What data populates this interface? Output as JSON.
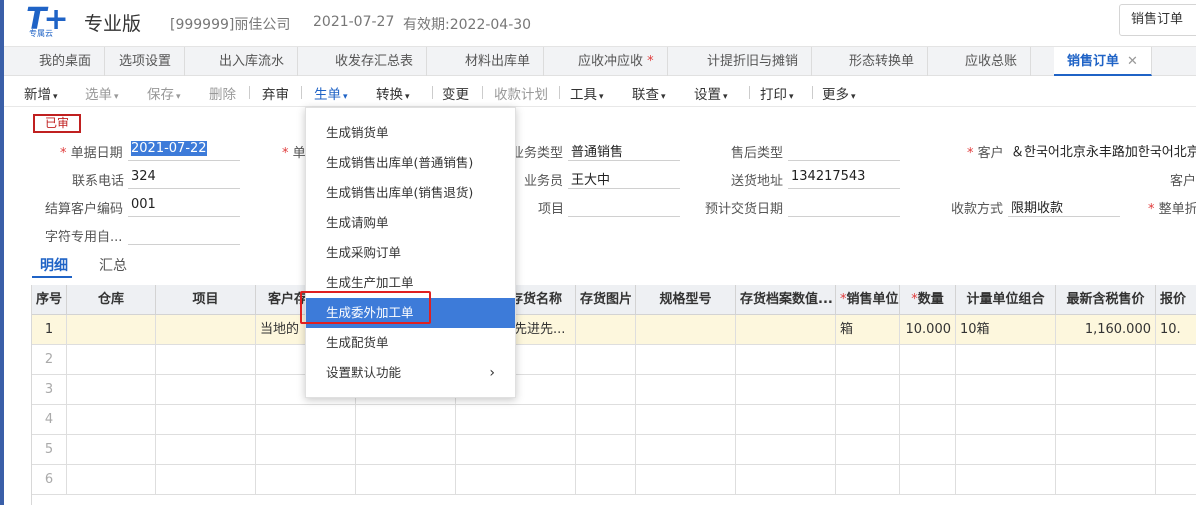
{
  "header": {
    "logo": "T+",
    "logo_sub": "专属云",
    "edition": "专业版",
    "company": "[999999]丽佳公司",
    "date": "2021-07-27",
    "validity": "有效期:2022-04-30",
    "top_button": "销售订单"
  },
  "tabs": [
    {
      "label": "我的桌面"
    },
    {
      "label": "选项设置"
    },
    {
      "label": "出入库流水"
    },
    {
      "label": "收发存汇总表"
    },
    {
      "label": "材料出库单"
    },
    {
      "label": "应收冲应收"
    },
    {
      "label": "计提折旧与摊销"
    },
    {
      "label": "形态转换单"
    },
    {
      "label": "应收总账"
    },
    {
      "label": "销售订单"
    }
  ],
  "toolbar": {
    "new": "新增",
    "select": "选单",
    "save": "保存",
    "delete": "删除",
    "discard": "弃审",
    "generate": "生单",
    "convert": "转换",
    "change": "变更",
    "collection_plan": "收款计划",
    "tools": "工具",
    "link_query": "联查",
    "settings": "设置",
    "print": "打印",
    "more": "更多"
  },
  "status_badge": "已审",
  "form": {
    "doc_date_label": "单据日期",
    "doc_date": "2021-07-22",
    "doc_no_label": "单",
    "biz_type_label": "业务类型",
    "biz_type": "普通销售",
    "after_sales_label": "售后类型",
    "after_sales": "",
    "customer_label": "客户",
    "customer": "＆한국어北京永丰路加한국어北京",
    "phone_label": "联系电话",
    "phone": "324",
    "salesman_label": "业务员",
    "salesman": "王大中",
    "ship_addr_label": "送货地址",
    "ship_addr": "134217543",
    "cust_partial_label": "客户",
    "settle_code_label": "结算客户编码",
    "settle_code": "001",
    "project_label": "项目",
    "project": "",
    "expected_date_label": "预计交货日期",
    "expected_date": "",
    "pay_method_label": "收款方式",
    "pay_method": "限期收款",
    "discount_label": "整单折",
    "char_field_label": "字符专用自...",
    "char_field": ""
  },
  "subtabs": {
    "detail": "明细",
    "summary": "汇总"
  },
  "grid": {
    "columns": [
      "序号",
      "仓库",
      "项目",
      "客户存",
      "",
      "存货名称",
      "存货图片",
      "规格型号",
      "存货档案数值...",
      "销售单位",
      "数量",
      "计量单位组合",
      "最新含税售价",
      "报价"
    ],
    "rows": [
      [
        "1",
        "",
        "",
        "当地的",
        "",
        "先进先...",
        "",
        "",
        "",
        "箱",
        "10.000",
        "10箱",
        "1,160.000",
        "10."
      ],
      [
        "2"
      ],
      [
        "3"
      ],
      [
        "4"
      ],
      [
        "5"
      ],
      [
        "6"
      ]
    ]
  },
  "dropdown": {
    "items": [
      "生成销货单",
      "生成销售出库单(普通销售)",
      "生成销售出库单(销售退货)",
      "生成请购单",
      "生成采购订单",
      "生成生产加工单",
      "生成委外加工单",
      "生成配货单",
      "设置默认功能"
    ]
  }
}
